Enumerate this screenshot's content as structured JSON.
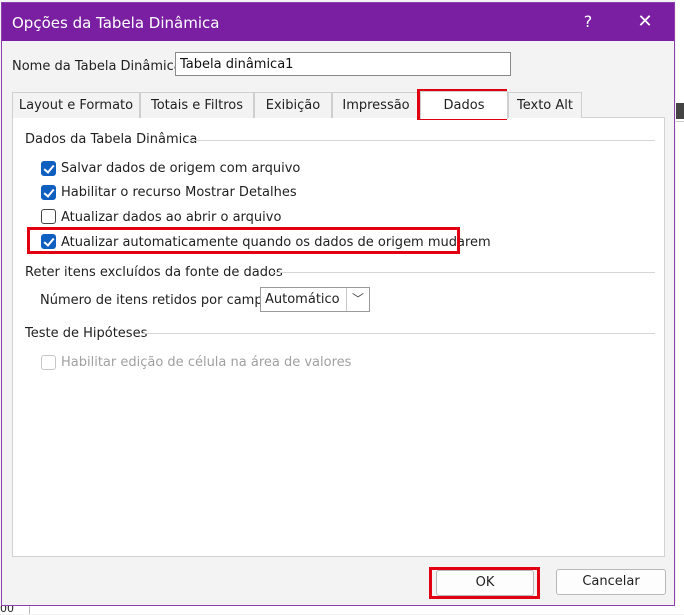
{
  "window": {
    "title": "Opções da Tabela Dinâmica",
    "help_glyph": "?",
    "close_glyph": "✕"
  },
  "name_field": {
    "label": "Nome da Tabela Dinâmica:",
    "value": "Tabela dinâmica1"
  },
  "tabs": [
    {
      "label": "Layout e Formato"
    },
    {
      "label": "Totais e Filtros"
    },
    {
      "label": "Exibição"
    },
    {
      "label": "Impressão"
    },
    {
      "label": "Dados",
      "active": true
    },
    {
      "label": "Texto Alt"
    }
  ],
  "sections": {
    "pivot_data": {
      "title": "Dados da Tabela Dinâmica",
      "options": [
        {
          "label": "Salvar dados de origem com arquivo",
          "checked": true
        },
        {
          "label": "Habilitar o recurso Mostrar Detalhes",
          "checked": true
        },
        {
          "label": "Atualizar dados ao abrir o arquivo",
          "checked": false
        },
        {
          "label": "Atualizar automaticamente quando os dados de origem mudarem",
          "checked": true
        }
      ]
    },
    "retain": {
      "title": "Reter itens excluídos da fonte de dados",
      "field_label": "Número de itens retidos por campo:",
      "select_value": "Automático",
      "select_arrow": "﹀"
    },
    "what_if": {
      "title": "Teste de Hipóteses",
      "option": {
        "label": "Habilitar edição de célula na área de valores",
        "checked": false,
        "disabled": true
      }
    }
  },
  "buttons": {
    "ok": "OK",
    "cancel": "Cancelar"
  },
  "highlight_color": "#e00012",
  "titlebar_color": "#7a1fa2",
  "background": {
    "bottom_text": "00"
  }
}
